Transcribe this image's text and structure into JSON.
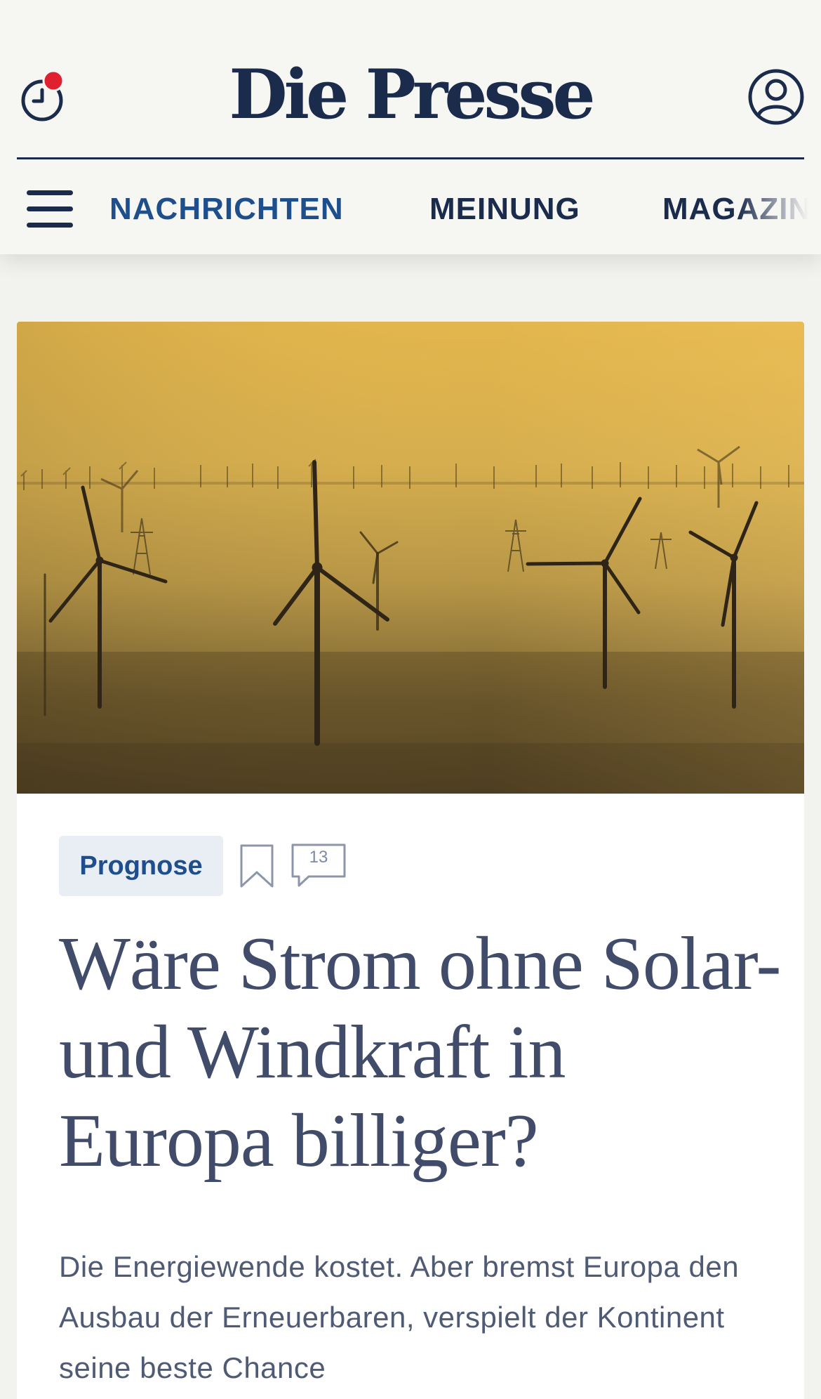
{
  "header": {
    "logo": "Die Presse",
    "history_icon": "history-clock-icon",
    "profile_icon": "user-account-icon",
    "notification_color": "#e0202e"
  },
  "nav": {
    "menu_icon": "hamburger-menu-icon",
    "items": [
      {
        "label": "NACHRICHTEN",
        "active": true
      },
      {
        "label": "MEINUNG",
        "active": false
      },
      {
        "label": "MAGAZIN",
        "active": false
      }
    ]
  },
  "article": {
    "image_description": "wind turbines on a hazy golden plain",
    "tag": "Prognose",
    "bookmark_icon": "bookmark-icon",
    "comments_icon": "comment-bubble-icon",
    "comment_count": "13",
    "headline": "Wäre Strom ohne Solar- und Windkraft in Europa billiger?",
    "lead": "Die Energiewende kostet. Aber bremst Europa den Ausbau der Erneuerbaren, verspielt der Kontinent seine beste Chance"
  },
  "colors": {
    "brand": "#1b2b4c",
    "accent": "#1e4f8c",
    "headline": "#414c6b",
    "background": "#f2f2ee"
  }
}
